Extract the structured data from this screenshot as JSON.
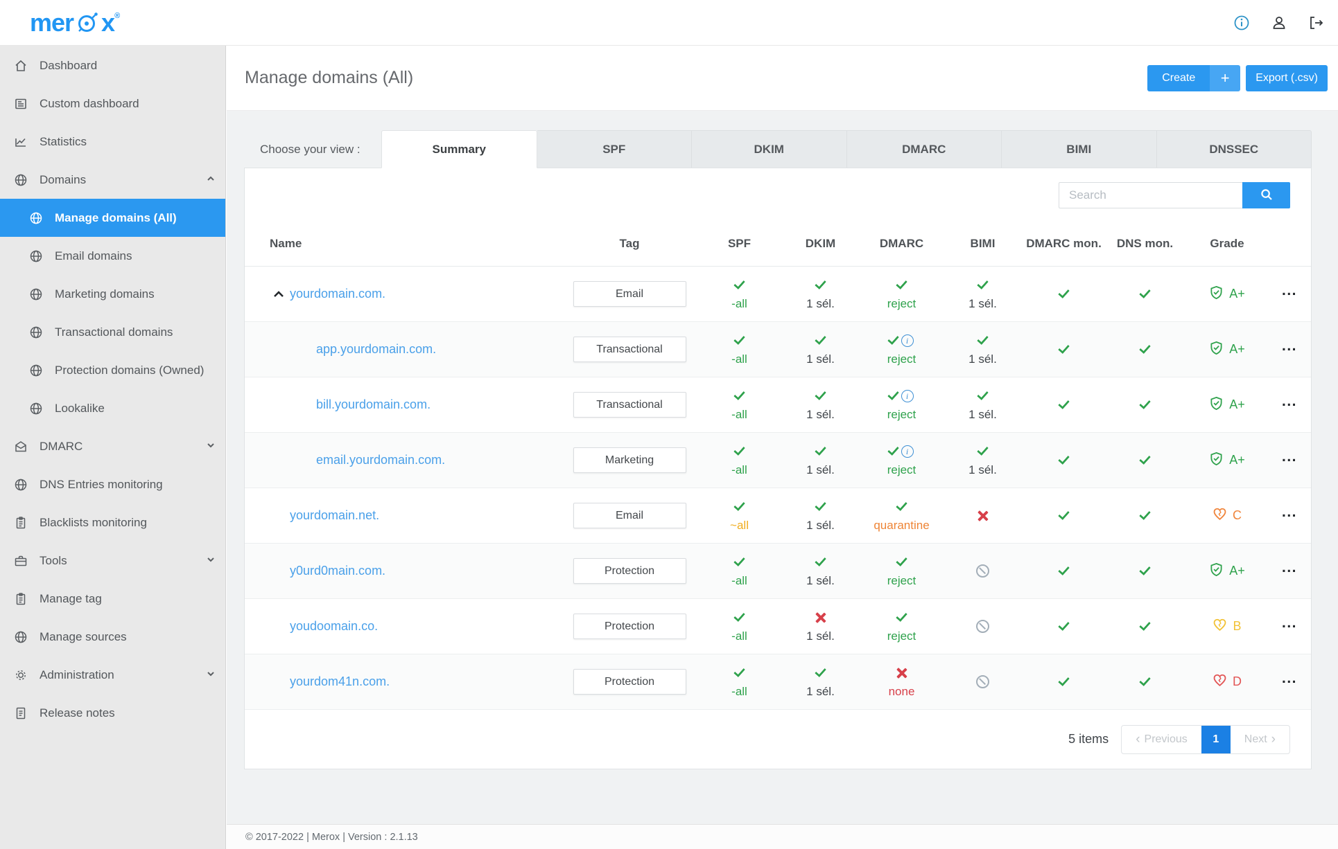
{
  "topbar": {
    "logo": "merox",
    "registered": "®",
    "actions": [
      {
        "icon": "info"
      },
      {
        "icon": "account"
      },
      {
        "icon": "logout"
      }
    ]
  },
  "sidebar": {
    "items": [
      {
        "label": "Dashboard",
        "icon": "home"
      },
      {
        "label": "Custom dashboard",
        "icon": "custom-dashboard"
      },
      {
        "label": "Statistics",
        "icon": "statistics"
      },
      {
        "label": "Domains",
        "icon": "globe",
        "chevron": "up"
      },
      {
        "label": "Manage domains (All)",
        "icon": "globe",
        "sub": true,
        "active": true
      },
      {
        "label": "Email domains",
        "icon": "globe",
        "sub": true
      },
      {
        "label": "Marketing domains",
        "icon": "globe",
        "sub": true
      },
      {
        "label": "Transactional domains",
        "icon": "globe",
        "sub": true
      },
      {
        "label": "Protection domains (Owned)",
        "icon": "globe",
        "sub": true
      },
      {
        "label": "Lookalike",
        "icon": "globe",
        "sub": true
      },
      {
        "label": "DMARC",
        "icon": "mail-open",
        "chevron": "down"
      },
      {
        "label": "DNS Entries monitoring",
        "icon": "globe"
      },
      {
        "label": "Blacklists monitoring",
        "icon": "clipboard"
      },
      {
        "label": "Tools",
        "icon": "briefcase",
        "chevron": "down"
      },
      {
        "label": "Manage tag",
        "icon": "clipboard"
      },
      {
        "label": "Manage sources",
        "icon": "globe"
      },
      {
        "label": "Administration",
        "icon": "gear",
        "chevron": "down"
      },
      {
        "label": "Release notes",
        "icon": "document"
      }
    ]
  },
  "page": {
    "title": "Manage domains (All)",
    "create_label": "Create",
    "create_plus": "+",
    "export_label": "Export (.csv)"
  },
  "view_switcher": {
    "label": "Choose your view :",
    "tabs": [
      {
        "label": "Summary",
        "active": true
      },
      {
        "label": "SPF"
      },
      {
        "label": "DKIM"
      },
      {
        "label": "DMARC"
      },
      {
        "label": "BIMI"
      },
      {
        "label": "DNSSEC"
      }
    ]
  },
  "search": {
    "placeholder": "Search"
  },
  "table": {
    "columns": [
      "Name",
      "Tag",
      "SPF",
      "DKIM",
      "DMARC",
      "BIMI",
      "DMARC mon.",
      "DNS mon.",
      "Grade"
    ],
    "rows": [
      {
        "name": "yourdomain.com.",
        "tag": "Email",
        "expander": true,
        "spf": {
          "icon": "ic-check",
          "value": "-all",
          "value_color": "vc-green"
        },
        "dkim": {
          "icon": "ic-check",
          "value": "1 sél.",
          "value_color": "vc-dark"
        },
        "dmarc": {
          "icon": "ic-check",
          "value": "reject",
          "value_color": "vc-green"
        },
        "bimi": {
          "icon": "ic-check",
          "value": "1 sél.",
          "value_color": "vc-dark"
        },
        "dmarc_mon": {
          "icon": "ic-check"
        },
        "dns_mon": {
          "icon": "ic-check"
        },
        "grade": {
          "letter": "A+",
          "icon": "shield",
          "color": "grade-green"
        }
      },
      {
        "name": "app.yourdomain.com.",
        "tag": "Transactional",
        "sub": true,
        "spf": {
          "icon": "ic-check",
          "value": "-all",
          "value_color": "vc-green"
        },
        "dkim": {
          "icon": "ic-check",
          "value": "1 sél.",
          "value_color": "vc-dark"
        },
        "dmarc": {
          "icon": "ic-check",
          "info": true,
          "value": "reject",
          "value_color": "vc-green"
        },
        "bimi": {
          "icon": "ic-check",
          "value": "1 sél.",
          "value_color": "vc-dark"
        },
        "dmarc_mon": {
          "icon": "ic-check"
        },
        "dns_mon": {
          "icon": "ic-check"
        },
        "grade": {
          "letter": "A+",
          "icon": "shield",
          "color": "grade-green"
        }
      },
      {
        "name": "bill.yourdomain.com.",
        "tag": "Transactional",
        "sub": true,
        "spf": {
          "icon": "ic-check",
          "value": "-all",
          "value_color": "vc-green"
        },
        "dkim": {
          "icon": "ic-check",
          "value": "1 sél.",
          "value_color": "vc-dark"
        },
        "dmarc": {
          "icon": "ic-check",
          "info": true,
          "value": "reject",
          "value_color": "vc-green"
        },
        "bimi": {
          "icon": "ic-check",
          "value": "1 sél.",
          "value_color": "vc-dark"
        },
        "dmarc_mon": {
          "icon": "ic-check"
        },
        "dns_mon": {
          "icon": "ic-check"
        },
        "grade": {
          "letter": "A+",
          "icon": "shield",
          "color": "grade-green"
        }
      },
      {
        "name": "email.yourdomain.com.",
        "tag": "Marketing",
        "sub": true,
        "spf": {
          "icon": "ic-check",
          "value": "-all",
          "value_color": "vc-green"
        },
        "dkim": {
          "icon": "ic-check",
          "value": "1 sél.",
          "value_color": "vc-dark"
        },
        "dmarc": {
          "icon": "ic-check",
          "info": true,
          "value": "reject",
          "value_color": "vc-green"
        },
        "bimi": {
          "icon": "ic-check",
          "value": "1 sél.",
          "value_color": "vc-dark"
        },
        "dmarc_mon": {
          "icon": "ic-check"
        },
        "dns_mon": {
          "icon": "ic-check"
        },
        "grade": {
          "letter": "A+",
          "icon": "shield",
          "color": "grade-green"
        }
      },
      {
        "name": "yourdomain.net.",
        "tag": "Email",
        "spf": {
          "icon": "ic-check",
          "value": "~all",
          "value_color": "vc-yellow"
        },
        "dkim": {
          "icon": "ic-check",
          "value": "1 sél.",
          "value_color": "vc-dark"
        },
        "dmarc": {
          "icon": "ic-check",
          "value": "quarantine",
          "value_color": "vc-orange"
        },
        "bimi": {
          "icon": "ic-cross",
          "value": "",
          "value_color": ""
        },
        "dmarc_mon": {
          "icon": "ic-check"
        },
        "dns_mon": {
          "icon": "ic-check"
        },
        "grade": {
          "letter": "C",
          "icon": "heart",
          "color": "grade-orange"
        }
      },
      {
        "name": "y0urd0main.com.",
        "tag": "Protection",
        "spf": {
          "icon": "ic-check",
          "value": "-all",
          "value_color": "vc-green"
        },
        "dkim": {
          "icon": "ic-check",
          "value": "1 sél.",
          "value_color": "vc-dark"
        },
        "dmarc": {
          "icon": "ic-check",
          "value": "reject",
          "value_color": "vc-green"
        },
        "bimi": {
          "icon": "ic-blocked",
          "value": "",
          "value_color": ""
        },
        "dmarc_mon": {
          "icon": "ic-check"
        },
        "dns_mon": {
          "icon": "ic-check"
        },
        "grade": {
          "letter": "A+",
          "icon": "shield",
          "color": "grade-green"
        }
      },
      {
        "name": "youdoomain.co.",
        "tag": "Protection",
        "spf": {
          "icon": "ic-check",
          "value": "-all",
          "value_color": "vc-green"
        },
        "dkim": {
          "icon": "ic-cross",
          "value": "1 sél.",
          "value_color": "vc-dark"
        },
        "dmarc": {
          "icon": "ic-check",
          "value": "reject",
          "value_color": "vc-green"
        },
        "bimi": {
          "icon": "ic-blocked",
          "value": "",
          "value_color": ""
        },
        "dmarc_mon": {
          "icon": "ic-check"
        },
        "dns_mon": {
          "icon": "ic-check"
        },
        "grade": {
          "letter": "B",
          "icon": "heart",
          "color": "grade-yellow"
        }
      },
      {
        "name": "yourdom41n.com.",
        "tag": "Protection",
        "spf": {
          "icon": "ic-check",
          "value": "-all",
          "value_color": "vc-green"
        },
        "dkim": {
          "icon": "ic-check",
          "value": "1 sél.",
          "value_color": "vc-dark"
        },
        "dmarc": {
          "icon": "ic-cross",
          "value": "none",
          "value_color": "vc-red"
        },
        "bimi": {
          "icon": "ic-blocked",
          "value": "",
          "value_color": ""
        },
        "dmarc_mon": {
          "icon": "ic-check"
        },
        "dns_mon": {
          "icon": "ic-check"
        },
        "grade": {
          "letter": "D",
          "icon": "heart",
          "color": "grade-red"
        }
      }
    ]
  },
  "pagination": {
    "items_count": "5 items",
    "previous": "Previous",
    "page": "1",
    "next": "Next"
  },
  "footer": {
    "text": "© 2017-2022 | Merox | Version : 2.1.13"
  }
}
